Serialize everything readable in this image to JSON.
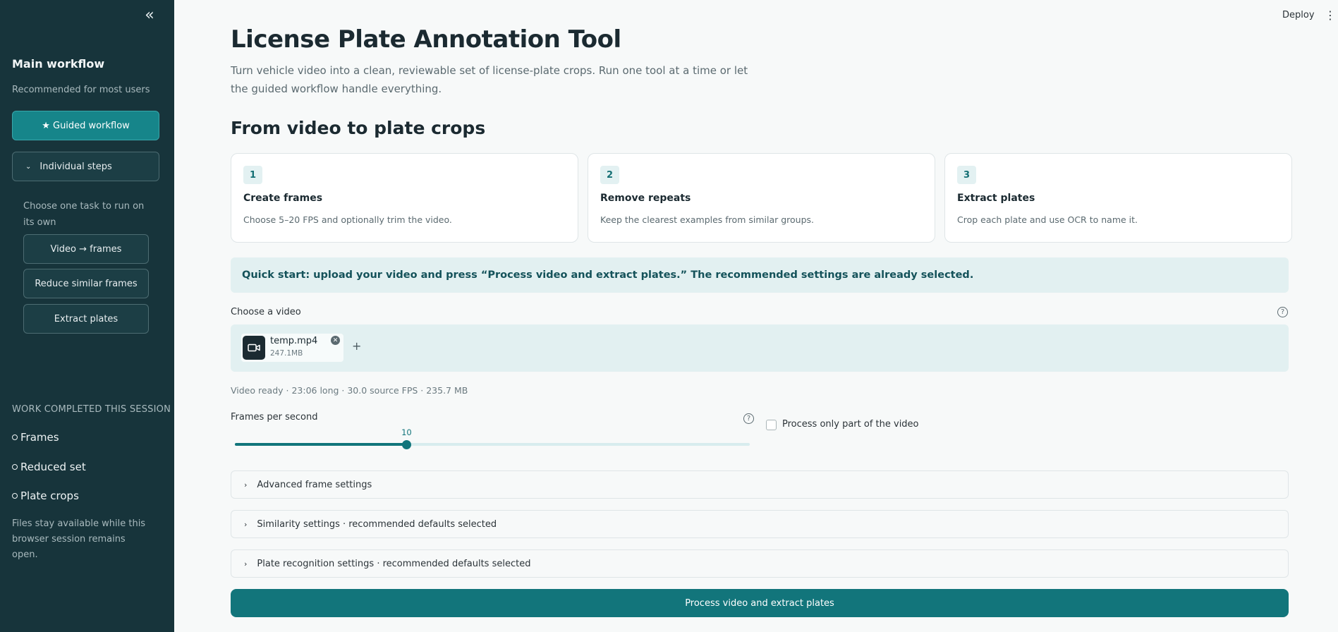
{
  "sidebar": {
    "collapse_icon": "double-chevron-left-icon",
    "title": "Main workflow",
    "subtitle": "Recommended for most users",
    "guided_label": "★ Guided workflow",
    "individual_label": "Individual steps",
    "individual_note": "Choose one task to run on its own",
    "steps": [
      "Video → frames",
      "Reduce similar frames",
      "Extract plates"
    ],
    "session_heading": "WORK COMPLETED THIS SESSION",
    "session_items": [
      "Frames",
      "Reduced set",
      "Plate crops"
    ],
    "footer_note": "Files stay available while this browser session remains open."
  },
  "topbar": {
    "deploy_label": "Deploy",
    "menu_icon": "kebab-menu-icon"
  },
  "main": {
    "title": "License Plate Annotation Tool",
    "intro": "Turn vehicle video into a clean, reviewable set of license-plate crops. Run one tool at a time or let the guided workflow handle everything.",
    "section_title": "From video to plate crops",
    "cards": [
      {
        "num": "1",
        "title": "Create frames",
        "desc": "Choose 5–20 FPS and optionally trim the video."
      },
      {
        "num": "2",
        "title": "Remove repeats",
        "desc": "Keep the clearest examples from similar groups."
      },
      {
        "num": "3",
        "title": "Extract plates",
        "desc": "Crop each plate and use OCR to name it."
      }
    ],
    "quick_start": "Quick start: upload your video and press “Process video and extract plates.” The recommended settings are already selected.",
    "upload": {
      "label": "Choose a video",
      "file_name": "temp.mp4",
      "file_size": "247.1MB",
      "add_label": "+"
    },
    "video_status": "Video ready · 23:06 long · 30.0 source FPS · 235.7 MB",
    "fps": {
      "label": "Frames per second",
      "value": "10",
      "fraction": 0.333
    },
    "partial_label": "Process only part of the video",
    "expanders": [
      "Advanced frame settings",
      "Similarity settings · recommended defaults selected",
      "Plate recognition settings · recommended defaults selected"
    ],
    "primary_label": "Process video and extract plates"
  },
  "colors": {
    "sidebar_bg": "#17343b",
    "accent": "#12757b",
    "accent_light": "#e2f0f1"
  }
}
